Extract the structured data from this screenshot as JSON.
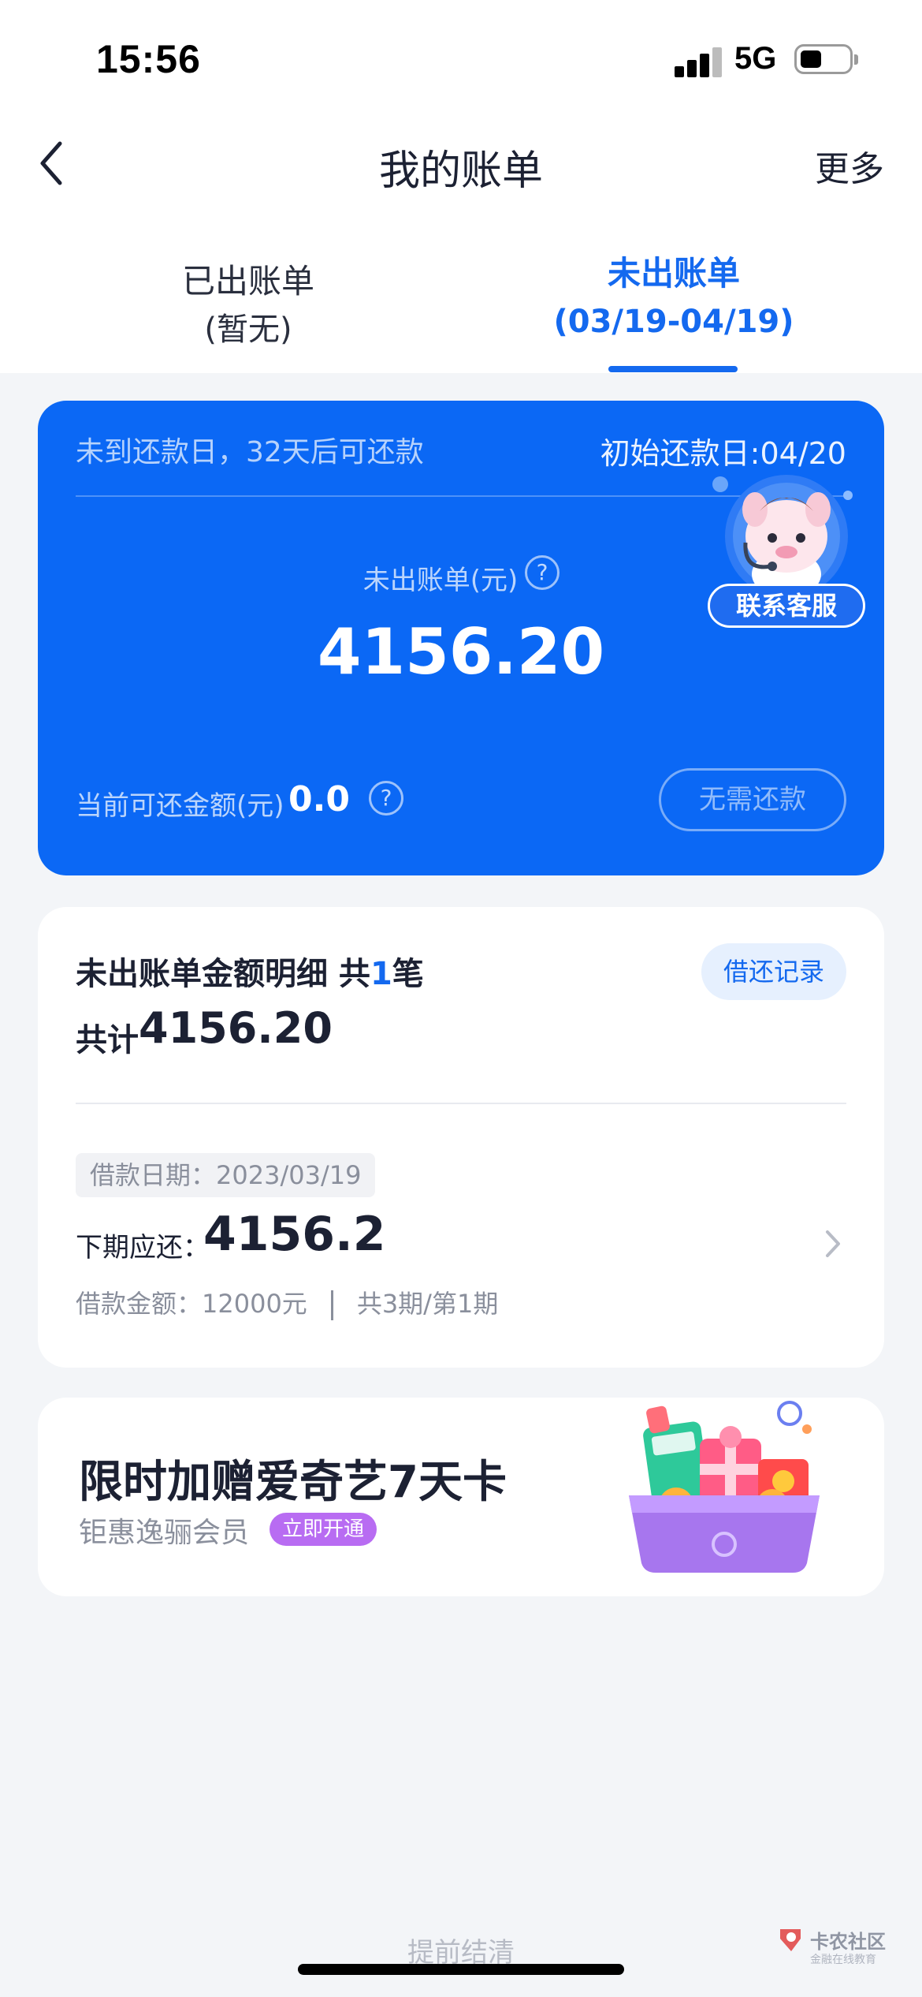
{
  "status_bar": {
    "time": "15:56",
    "network": "5G"
  },
  "nav": {
    "title": "我的账单",
    "more": "更多"
  },
  "tabs": [
    {
      "line1": "已出账单",
      "line2": "(暂无)",
      "active": false
    },
    {
      "line1": "未出账单",
      "line2": "(03/19-04/19)",
      "active": true
    }
  ],
  "bill_card": {
    "notice": "未到还款日，32天后可还款",
    "initial_due": "初始还款日:04/20",
    "amount_label": "未出账单(元)",
    "amount": "4156.20",
    "current_label": "当前可还金额(元)",
    "current_value": "0.0",
    "button_label": "无需还款",
    "customer_service": "联系客服",
    "help_glyph": "?"
  },
  "detail": {
    "title_prefix": "未出账单金额明细 共",
    "count": "1",
    "title_suffix": "笔",
    "records_button": "借还记录",
    "total_label": "共计",
    "total_value": "4156.20",
    "date_chip": "借款日期：2023/03/19",
    "next_label": "下期应还：",
    "next_value": "4156.2",
    "loan_amount": "借款金额：12000元",
    "installments": "共3期/第1期"
  },
  "promo": {
    "title": "限时加赠爱奇艺7天卡",
    "subtitle": "钜惠逸骊会员",
    "badge": "立即开通"
  },
  "footer": {
    "text": "提前结清"
  },
  "watermark": {
    "line1": "卡农社区",
    "line2": "金融在线教育"
  },
  "colors": {
    "accent": "#1469ef",
    "card_blue": "#0b68f5",
    "promo_badge": "#b86cf2"
  },
  "icons": [
    "back-arrow-icon",
    "help-circle-icon",
    "chevron-right-icon",
    "customer-service-mascot-icon",
    "gift-box-illustration"
  ]
}
